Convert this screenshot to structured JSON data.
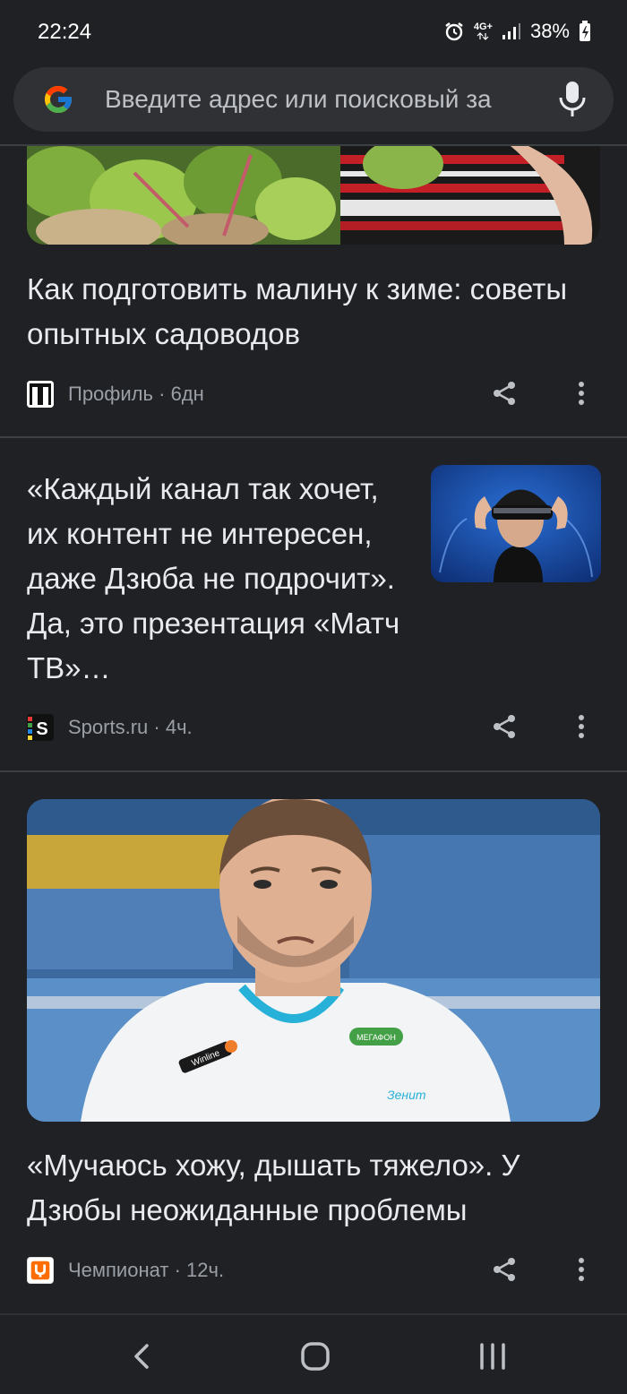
{
  "status_bar": {
    "time": "22:24",
    "network": "4G+",
    "battery": "38%"
  },
  "search": {
    "placeholder": "Введите адрес или поисковый за"
  },
  "articles": [
    {
      "headline": "Как подготовить малину к зиме: советы опытных садоводов",
      "source": "Профиль",
      "age": "6дн",
      "separator": "·"
    },
    {
      "headline": "«Каждый канал так хочет, их контент не интересен, даже Дзюба не подрочит». Да, это презентация «Матч ТВ»…",
      "source": "Sports.ru",
      "age": "4ч.",
      "separator": "·"
    },
    {
      "headline": "«Мучаюсь хожу, дышать тяжело». У Дзюбы неожиданные проблемы",
      "source": "Чемпионат",
      "age": "12ч.",
      "separator": "·"
    }
  ],
  "photo": {
    "jersey_sponsor": "Winline",
    "jersey_badge": "МЕГАФОН",
    "crest_text": "Зенит"
  },
  "icons": [
    "alarm-icon",
    "signal-icon",
    "battery-icon",
    "google-logo-icon",
    "mic-icon",
    "share-icon",
    "more-vert-icon",
    "back-icon",
    "home-icon",
    "recents-icon"
  ],
  "colors": {
    "background": "#202124",
    "search_bg": "#303134",
    "text": "#e8eaed",
    "meta": "#9aa0a6",
    "divider": "#3c4043"
  }
}
